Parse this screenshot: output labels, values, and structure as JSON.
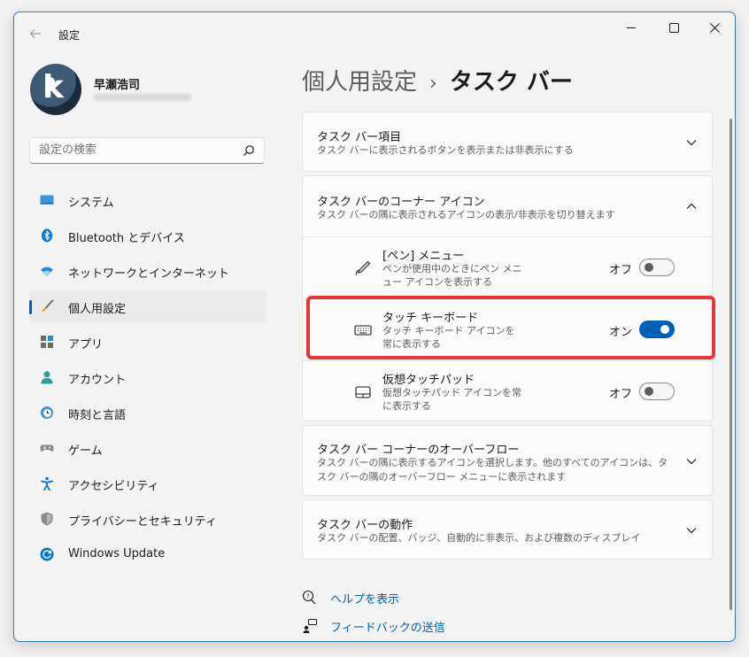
{
  "window": {
    "title": "設定"
  },
  "profile": {
    "name": "早瀬浩司"
  },
  "search": {
    "placeholder": "設定の検索"
  },
  "nav": {
    "items": [
      {
        "label": "システム",
        "icon": "display-icon"
      },
      {
        "label": "Bluetooth とデバイス",
        "icon": "bluetooth-icon"
      },
      {
        "label": "ネットワークとインターネット",
        "icon": "wifi-icon"
      },
      {
        "label": "個人用設定",
        "icon": "brush-icon",
        "selected": true
      },
      {
        "label": "アプリ",
        "icon": "apps-icon"
      },
      {
        "label": "アカウント",
        "icon": "person-icon"
      },
      {
        "label": "時刻と言語",
        "icon": "clock-globe-icon"
      },
      {
        "label": "ゲーム",
        "icon": "gamepad-icon"
      },
      {
        "label": "アクセシビリティ",
        "icon": "accessibility-icon"
      },
      {
        "label": "プライバシーとセキュリティ",
        "icon": "shield-icon"
      },
      {
        "label": "Windows Update",
        "icon": "update-icon"
      }
    ]
  },
  "breadcrumb": {
    "parent": "個人用設定",
    "separator": "›",
    "current": "タスク バー"
  },
  "cards": {
    "items": {
      "title": "タスク バー項目",
      "desc": "タスク バーに表示されるボタンを表示または非表示にする"
    },
    "corner": {
      "title": "タスク バーのコーナー アイコン",
      "desc": "タスク バーの隅に表示されるアイコンの表示/非表示を切り替えます",
      "rows": [
        {
          "title": "[ペン] メニュー",
          "desc": "ペンが使用中のときにペン メニュー アイコンを表示する",
          "state_label": "オフ",
          "on": false
        },
        {
          "title": "タッチ キーボード",
          "desc": "タッチ キーボード アイコンを常に表示する",
          "state_label": "オン",
          "on": true
        },
        {
          "title": "仮想タッチパッド",
          "desc": "仮想タッチパッド アイコンを常に表示する",
          "state_label": "オフ",
          "on": false
        }
      ]
    },
    "overflow": {
      "title": "タスク バー コーナーのオーバーフロー",
      "desc": "タスク バーの隅に表示するアイコンを選択します。他のすべてのアイコンは、タスク バーの隅のオーバーフロー メニューに表示されます"
    },
    "behavior": {
      "title": "タスク バーの動作",
      "desc": "タスク バーの配置、バッジ、自動的に非表示、および複数のディスプレイ"
    }
  },
  "links": {
    "help": "ヘルプを表示",
    "feedback": "フィードバックの送信"
  },
  "colors": {
    "accent": "#005fb8",
    "highlight": "#e8353b",
    "window_border": "#2f7cc9"
  }
}
